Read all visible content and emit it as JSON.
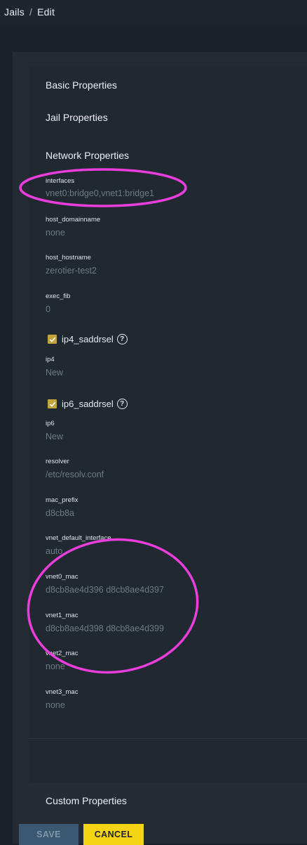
{
  "breadcrumb": {
    "root": "Jails",
    "separator": "/",
    "current": "Edit"
  },
  "sections": {
    "basic": "Basic Properties",
    "jail": "Jail Properties",
    "network": "Network Properties",
    "custom": "Custom Properties"
  },
  "fields": {
    "interfaces": {
      "label": "interfaces",
      "value": "vnet0:bridge0,vnet1:bridge1"
    },
    "host_domainname": {
      "label": "host_domainname",
      "value": "none"
    },
    "host_hostname": {
      "label": "host_hostname",
      "value": "zerotier-test2"
    },
    "exec_fib": {
      "label": "exec_fib",
      "value": "0"
    },
    "ip4_saddrsel": {
      "label": "ip4_saddrsel",
      "checked": true
    },
    "ip4": {
      "label": "ip4",
      "value": "New"
    },
    "ip6_saddrsel": {
      "label": "ip6_saddrsel",
      "checked": true
    },
    "ip6": {
      "label": "ip6",
      "value": "New"
    },
    "resolver": {
      "label": "resolver",
      "value": "/etc/resolv.conf"
    },
    "mac_prefix": {
      "label": "mac_prefix",
      "value": "d8cb8a"
    },
    "vnet_default_interface": {
      "label": "vnet_default_interface",
      "value": "auto"
    },
    "vnet0_mac": {
      "label": "vnet0_mac",
      "value": "d8cb8ae4d396 d8cb8ae4d397"
    },
    "vnet1_mac": {
      "label": "vnet1_mac",
      "value": "d8cb8ae4d398 d8cb8ae4d399"
    },
    "vnet2_mac": {
      "label": "vnet2_mac",
      "value": "none"
    },
    "vnet3_mac": {
      "label": "vnet3_mac",
      "value": "none"
    }
  },
  "help_icon": "help-circle-icon",
  "check_icon": "checkmark-icon",
  "buttons": {
    "save": "SAVE",
    "cancel": "CANCEL"
  },
  "colors": {
    "accent": "#f5d414",
    "checkbox": "#c3a33e",
    "annotation": "#e93ddc",
    "save_disabled": "#3b5872"
  }
}
